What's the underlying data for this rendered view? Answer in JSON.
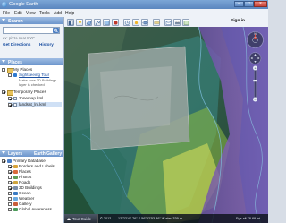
{
  "window": {
    "title": "Google Earth",
    "minimize": "–",
    "maximize": "□",
    "close": "×"
  },
  "menu": [
    "File",
    "Edit",
    "View",
    "Tools",
    "Add",
    "Help"
  ],
  "search": {
    "header": "Search",
    "value": "",
    "hint": "ex: pizza near NYC",
    "get_directions": "Get Directions",
    "history": "History"
  },
  "places": {
    "header": "Places",
    "items": [
      {
        "label": "My Places",
        "checked": false,
        "icon": "folder-icon"
      },
      {
        "label": "Sightseeing Tour",
        "checked": false,
        "icon": "tour-icon"
      },
      {
        "label": "Make sure 3D Buildings",
        "checked": null,
        "icon": ""
      },
      {
        "label": "layer is checked",
        "checked": null,
        "icon": ""
      },
      {
        "label": "Temporary Places",
        "checked": true,
        "icon": "folder-icon"
      },
      {
        "label": "zonemap.kml",
        "checked": true,
        "icon": "doc-icon"
      },
      {
        "label": "landsat_lnl.kml",
        "checked": true,
        "icon": "doc-icon"
      }
    ]
  },
  "layers": {
    "header": "Layers",
    "gallery_label": "Earth Gallery",
    "items": [
      {
        "label": "Primary Database",
        "checked": true,
        "color": "#4a7fc8"
      },
      {
        "label": "Borders and Labels",
        "checked": true,
        "color": "#d9a43a"
      },
      {
        "label": "Places",
        "checked": true,
        "color": "#d86b3a"
      },
      {
        "label": "Photos",
        "checked": false,
        "color": "#5e9e54"
      },
      {
        "label": "Roads",
        "checked": true,
        "color": "#cfa53e"
      },
      {
        "label": "3D Buildings",
        "checked": true,
        "color": "#7b8ea8"
      },
      {
        "label": "Ocean",
        "checked": false,
        "color": "#3a7ac2"
      },
      {
        "label": "Weather",
        "checked": false,
        "color": "#6aa9e0"
      },
      {
        "label": "Gallery",
        "checked": false,
        "color": "#c95e3a"
      },
      {
        "label": "Global Awareness",
        "checked": false,
        "color": "#4c9b5a"
      }
    ]
  },
  "topbar": {
    "signin": "Sign in"
  },
  "status": {
    "tour_guide": "Tour Guide",
    "year": "© 2012",
    "coords": "12°22'47.76\" S  56°52'53.36\" W  elev  339 m",
    "eye_alt": "Eye alt  78.69 mi"
  }
}
